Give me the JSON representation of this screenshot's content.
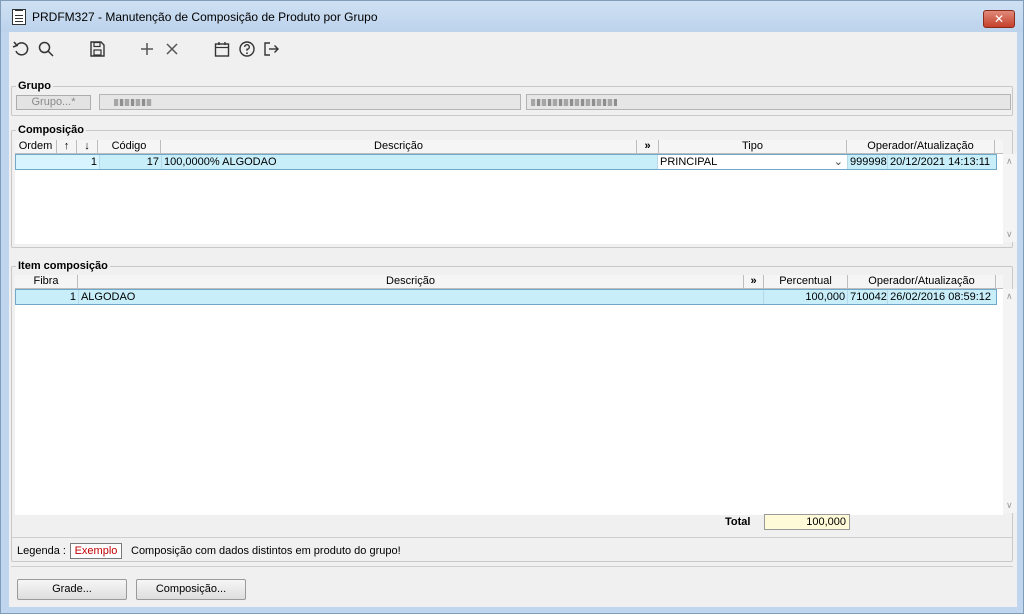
{
  "window": {
    "title": "PRDFM327 - Manutenção de Composição de Produto por Grupo",
    "close_label": "✕"
  },
  "toolbar": {
    "icons": [
      "undo-icon",
      "search-icon",
      "save-icon",
      "add-icon",
      "delete-icon",
      "calendar-icon",
      "help-icon",
      "exit-icon"
    ]
  },
  "grupo": {
    "legend": "Grupo",
    "button_label": "Grupo...*"
  },
  "composicao": {
    "legend": "Composição",
    "columns": [
      "Ordem",
      "↑",
      "↓",
      "Código",
      "Descrição",
      "»",
      "Tipo",
      "Operador/Atualização"
    ],
    "rows": [
      {
        "ordem": "1",
        "codigo": "17",
        "descricao": "100,0000% ALGODAO",
        "tipo": "PRINCIPAL",
        "operador": "999998",
        "atualizacao": "20/12/2021 14:13:11"
      }
    ]
  },
  "item_composicao": {
    "legend": "Item composição",
    "columns": [
      "Fibra",
      "Descrição",
      "»",
      "Percentual",
      "Operador/Atualização"
    ],
    "rows": [
      {
        "fibra": "1",
        "descricao": "ALGODAO",
        "percentual": "100,000",
        "operador": "710042",
        "atualizacao": "26/02/2016 08:59:12"
      }
    ],
    "total_label": "Total",
    "total_value": "100,000"
  },
  "legenda": {
    "label": "Legenda :",
    "example": "Exemplo",
    "text": "Composição com dados distintos em produto do grupo!"
  },
  "buttons": {
    "grade": "Grade...",
    "composicao": "Composição..."
  },
  "colors": {
    "selected_row": "#c8eefa",
    "total_bg": "#fffbd8",
    "example_text": "#c00000"
  }
}
